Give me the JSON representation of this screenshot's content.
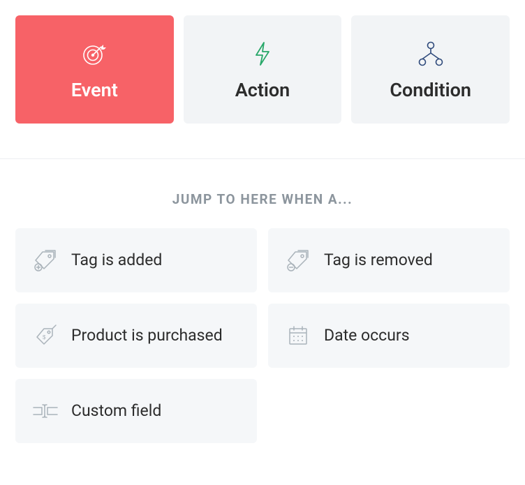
{
  "tabs": [
    {
      "label": "Event",
      "active": true,
      "icon": "target"
    },
    {
      "label": "Action",
      "active": false,
      "icon": "bolt"
    },
    {
      "label": "Condition",
      "active": false,
      "icon": "branch"
    }
  ],
  "section_title": "JUMP TO HERE WHEN A...",
  "options": [
    {
      "label": "Tag is added",
      "icon": "tag-add"
    },
    {
      "label": "Tag is removed",
      "icon": "tag-remove"
    },
    {
      "label": "Product is purchased",
      "icon": "price-tag"
    },
    {
      "label": "Date occurs",
      "icon": "calendar"
    },
    {
      "label": "Custom field",
      "icon": "text-cursor"
    }
  ],
  "colors": {
    "accent": "#f76267",
    "bolt": "#27a768",
    "branch": "#2f4a7b",
    "muted_icon": "#aab3ba"
  }
}
